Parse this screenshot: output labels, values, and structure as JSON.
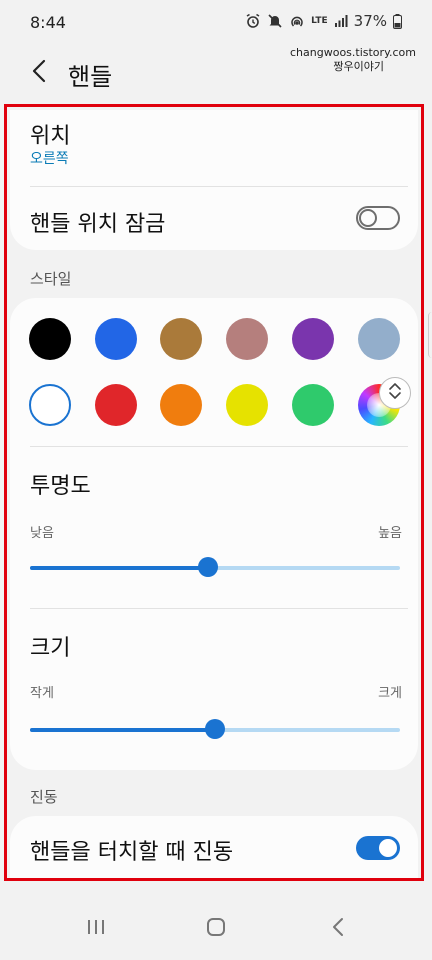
{
  "status_bar": {
    "time": "8:44",
    "network": "LTE",
    "battery": "37%"
  },
  "header": {
    "title": "핸들",
    "back_icon": "chevron-left-icon"
  },
  "watermark": {
    "line1": "changwoos.tistory.com",
    "line2": "짱우이야기"
  },
  "position_setting": {
    "title": "위치",
    "value": "오른쪽"
  },
  "lock_setting": {
    "label": "핸들 위치 잠금",
    "enabled": false
  },
  "style_section": {
    "label": "스타일",
    "swatches": [
      {
        "name": "black",
        "color": "#000000",
        "selected": false
      },
      {
        "name": "blue",
        "color": "#2266e6",
        "selected": false
      },
      {
        "name": "brown",
        "color": "#aa7a3a",
        "selected": false
      },
      {
        "name": "rose",
        "color": "#b57f7d",
        "selected": false
      },
      {
        "name": "purple",
        "color": "#7a35ad",
        "selected": false
      },
      {
        "name": "gray-blue",
        "color": "#93aecb",
        "selected": false
      },
      {
        "name": "white",
        "color": "#ffffff",
        "selected": true
      },
      {
        "name": "red",
        "color": "#e0262a",
        "selected": false
      },
      {
        "name": "orange",
        "color": "#f07d0e",
        "selected": false
      },
      {
        "name": "yellow",
        "color": "#e6e200",
        "selected": false
      },
      {
        "name": "green",
        "color": "#2fca6c",
        "selected": false
      },
      {
        "name": "custom",
        "color": "rainbow",
        "selected": false
      }
    ]
  },
  "transparency": {
    "title": "투명도",
    "min_label": "낮음",
    "max_label": "높음",
    "value": 0.48
  },
  "size": {
    "title": "크기",
    "min_label": "작게",
    "max_label": "크게",
    "value": 0.5
  },
  "vibration_section": {
    "label": "진동",
    "setting_label": "핸들을 터치할 때 진동",
    "enabled": true
  },
  "colors": {
    "accent": "#1a73d1",
    "highlight_frame": "#e0000d",
    "link_text": "#0a7bb6"
  },
  "nav_bar": {
    "recents_icon": "recents-icon",
    "home_icon": "home-icon",
    "back_icon": "back-icon"
  }
}
